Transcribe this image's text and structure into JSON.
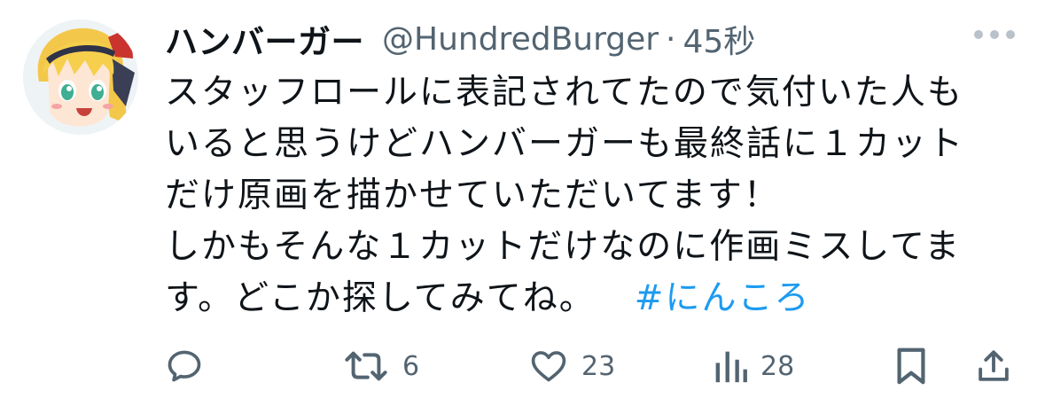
{
  "tweet": {
    "display_name": "ハンバーガー",
    "handle": "@HundredBurger",
    "separator": "·",
    "time": "45秒",
    "body_lines": [
      "スタッフロールに表記されてたので気付いた人も",
      "いると思うけどハンバーガーも最終話に１カット",
      "だけ原画を描かせていただいてます！",
      "しかもそんな１カットだけなのに作画ミスしてま",
      "す。どこか探してみてね。"
    ],
    "hashtag": "#にんころ"
  },
  "actions": {
    "reply_count": "",
    "retweet_count": "6",
    "like_count": "23",
    "views_count": "28"
  },
  "icons": [
    "avatar",
    "more-icon",
    "reply-icon",
    "retweet-icon",
    "like-icon",
    "views-icon",
    "bookmark-icon",
    "share-icon"
  ],
  "colors": {
    "text": "#0f1419",
    "secondary": "#536471",
    "link": "#1d9bf0"
  }
}
